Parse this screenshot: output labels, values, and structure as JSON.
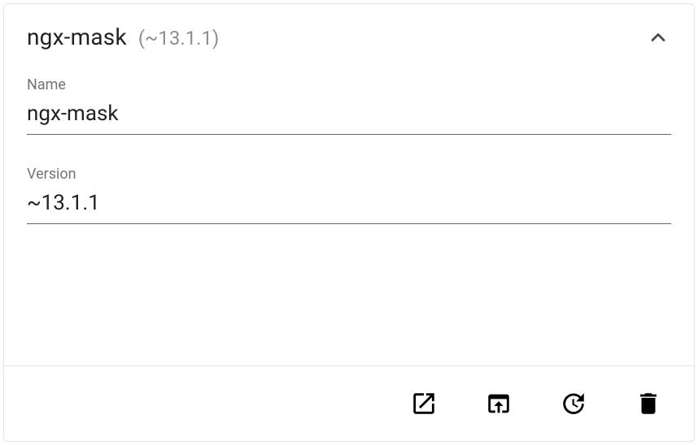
{
  "header": {
    "title": "ngx-mask",
    "subtitle": "(~13.1.1)"
  },
  "fields": {
    "name": {
      "label": "Name",
      "value": "ngx-mask"
    },
    "version": {
      "label": "Version",
      "value": "~13.1.1"
    }
  },
  "icons": {
    "chevronUp": "chevron-up-icon",
    "openNew": "open-in-new-icon",
    "openBrowser": "open-in-browser-icon",
    "update": "update-icon",
    "delete": "delete-icon"
  }
}
